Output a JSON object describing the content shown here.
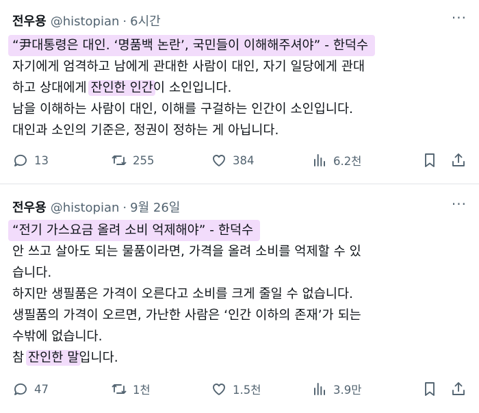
{
  "tweets": [
    {
      "name": "전우용",
      "handle": "@histopian",
      "separator": "·",
      "time": "6시간",
      "more": "···",
      "quote": "“尹대통령은 대인. ‘명품백 논란’, 국민들이 이해해주셔야” - 한덕수",
      "line2": "자기에게 엄격하고 남에게 관대한 사람이 대인, 자기 일당에게 관대",
      "line3_pre": "하고 상대에게 ",
      "line3_hl": "잔인한 인간",
      "line3_post": "이 소인입니다.",
      "line4": "남을 이해하는 사람이 대인, 이해를 구걸하는 인간이 소인입니다.",
      "line5": "대인과 소인의 기준은, 정권이 정하는 게 아닙니다.",
      "stats": {
        "replies": "13",
        "reposts": "255",
        "likes": "384",
        "views": "6.2천"
      }
    },
    {
      "name": "전우용",
      "handle": "@histopian",
      "separator": "·",
      "time": "9월 26일",
      "more": "···",
      "quote": "“전기 가스요금 올려 소비 억제해야” - 한덕수",
      "line2": "안 쓰고 살아도 되는 물품이라면, 가격을 올려 소비를 억제할 수 있",
      "line3": "습니다.",
      "line4": "하지만 생필품은 가격이 오른다고 소비를 크게 줄일 수 없습니다.",
      "line5": "생필품의 가격이 오르면, 가난한 사람은 ‘인간 이하의 존재’가 되는",
      "line6": "수밖에 없습니다.",
      "line7_pre": "참 ",
      "line7_hl": "잔인한 말",
      "line7_post": "입니다.",
      "stats": {
        "replies": "47",
        "reposts": "1천",
        "likes": "1.5천",
        "views": "3.9만"
      }
    }
  ],
  "icons": [
    "reply-icon",
    "repost-icon",
    "like-icon",
    "views-icon",
    "bookmark-icon",
    "share-icon"
  ],
  "colors": {
    "highlight": "#f2dcfb",
    "muted": "#536471",
    "text": "#0f1419"
  }
}
